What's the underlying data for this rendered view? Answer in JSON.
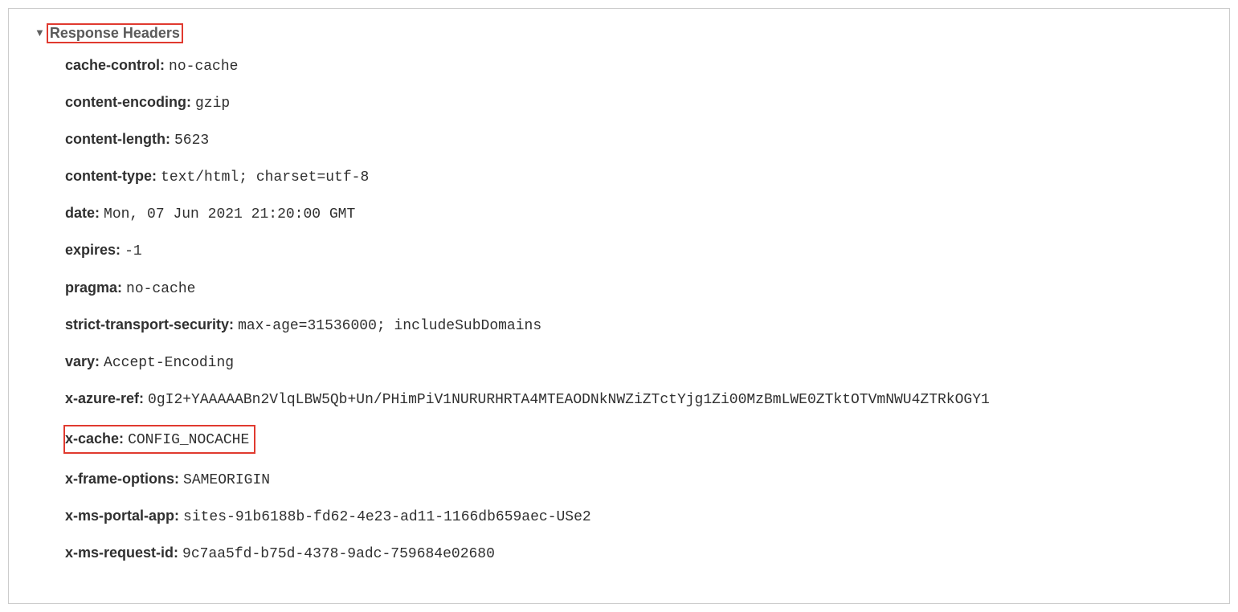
{
  "section": {
    "title": "Response Headers"
  },
  "headers": {
    "cache_control": {
      "name": "cache-control:",
      "value": "no-cache"
    },
    "content_encoding": {
      "name": "content-encoding:",
      "value": "gzip"
    },
    "content_length": {
      "name": "content-length:",
      "value": "5623"
    },
    "content_type": {
      "name": "content-type:",
      "value": "text/html; charset=utf-8"
    },
    "date": {
      "name": "date:",
      "value": "Mon, 07 Jun 2021 21:20:00 GMT"
    },
    "expires": {
      "name": "expires:",
      "value": "-1"
    },
    "pragma": {
      "name": "pragma:",
      "value": "no-cache"
    },
    "strict_transport_security": {
      "name": "strict-transport-security:",
      "value": "max-age=31536000; includeSubDomains"
    },
    "vary": {
      "name": "vary:",
      "value": "Accept-Encoding"
    },
    "x_azure_ref": {
      "name": "x-azure-ref:",
      "value": "0gI2+YAAAAABn2VlqLBW5Qb+Un/PHimPiV1NURURHRTA4MTEAODNkNWZiZTctYjg1Zi00MzBmLWE0ZTktOTVmNWU4ZTRkOGY1"
    },
    "x_cache": {
      "name": "x-cache:",
      "value": "CONFIG_NOCACHE"
    },
    "x_frame_options": {
      "name": "x-frame-options:",
      "value": "SAMEORIGIN"
    },
    "x_ms_portal_app": {
      "name": "x-ms-portal-app:",
      "value": "sites-91b6188b-fd62-4e23-ad11-1166db659aec-USe2"
    },
    "x_ms_request_id": {
      "name": "x-ms-request-id:",
      "value": "9c7aa5fd-b75d-4378-9adc-759684e02680"
    }
  }
}
